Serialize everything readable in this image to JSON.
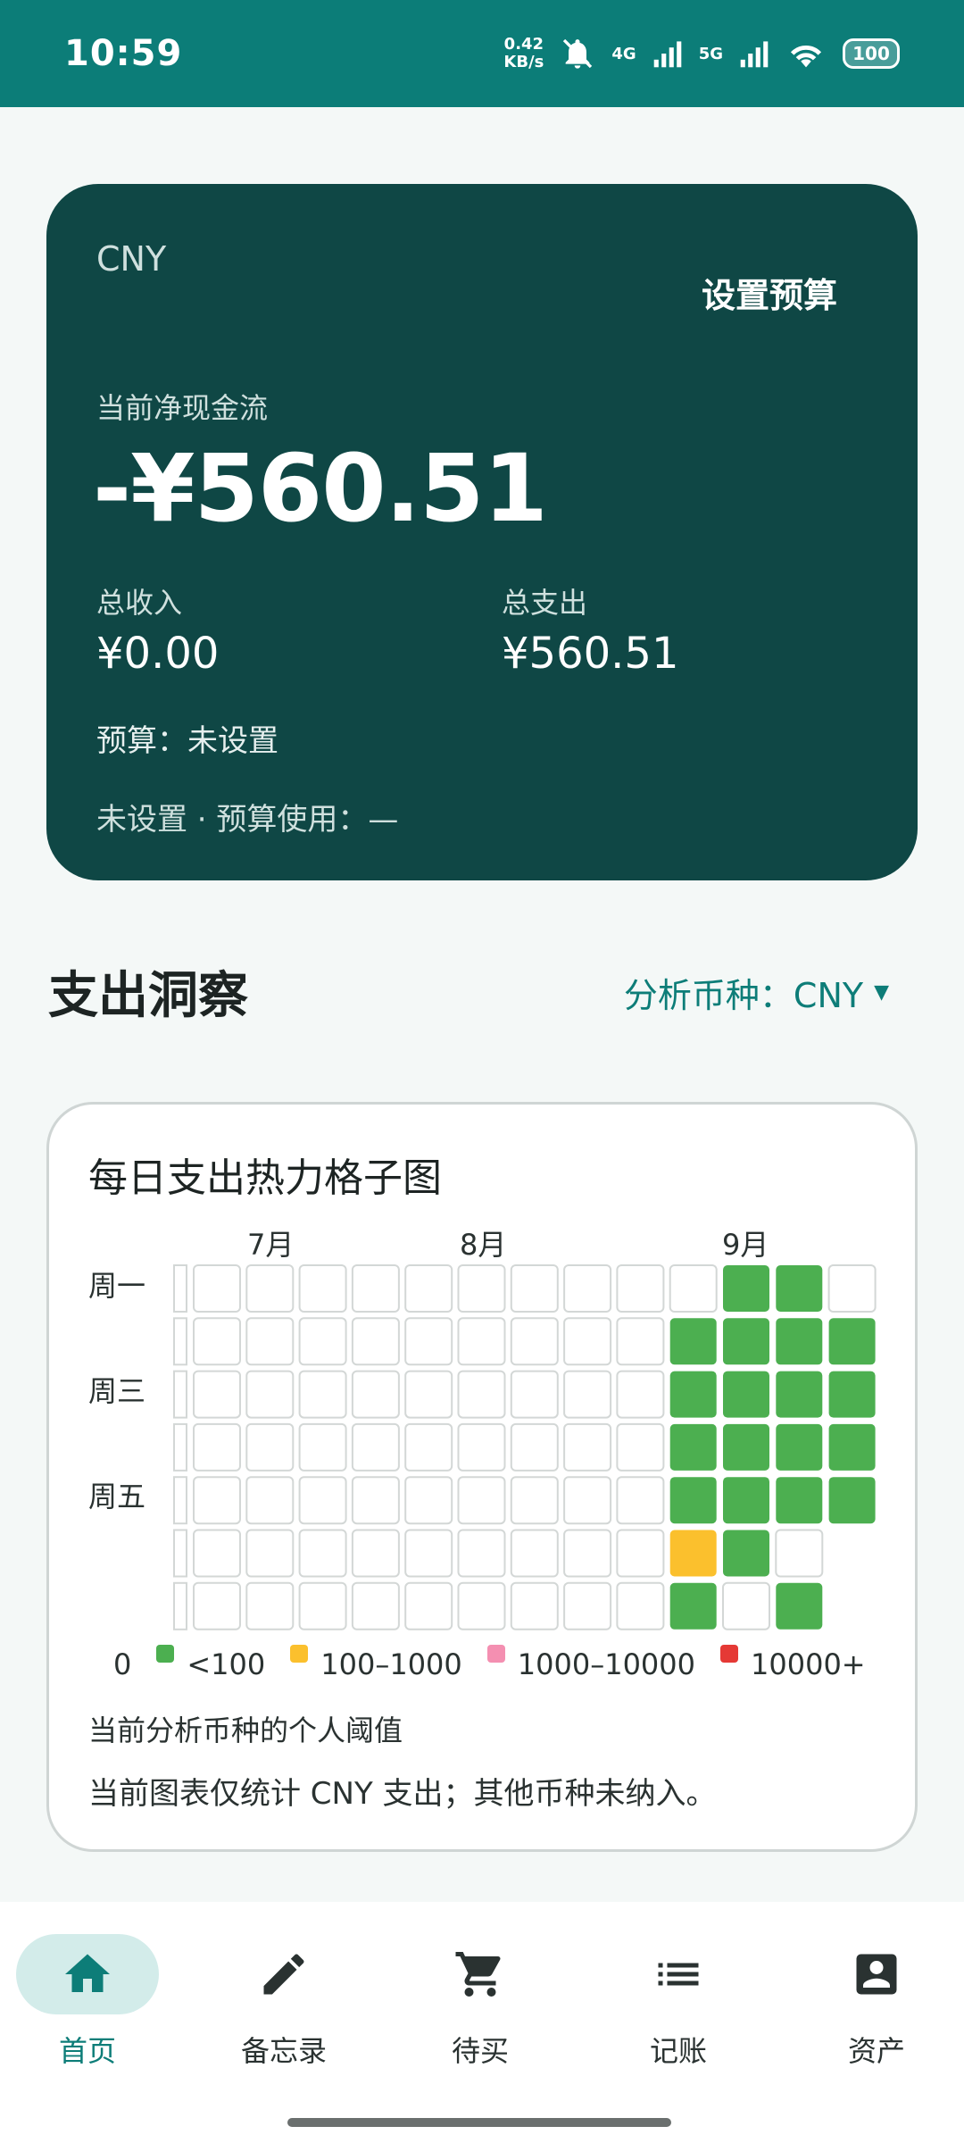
{
  "status_bar": {
    "time": "10:59",
    "speed_value": "0.42",
    "speed_unit": "KB/s",
    "net1": "4G",
    "net2": "5G",
    "battery": "100"
  },
  "net_card": {
    "currency": "CNY",
    "set_budget_label": "设置预算",
    "net_label": "当前净现金流",
    "net_value": "-¥560.51",
    "income_label": "总收入",
    "income_value": "¥0.00",
    "expense_label": "总支出",
    "expense_value": "¥560.51",
    "budget_line": "预算：未设置",
    "budget_usage": "未设置 · 预算使用：—"
  },
  "insights": {
    "title": "支出洞察",
    "currency_selector": "分析币种：CNY"
  },
  "heatmap": {
    "title": "每日支出热力格子图",
    "months": [
      "7月",
      "8月",
      "9月"
    ],
    "weekdays": [
      "周一",
      "周三",
      "周五"
    ],
    "colors": {
      "none": "#ffffff",
      "lt100": "#4caf50",
      "100_1000": "#fbc02d",
      "1000_10000": "#f48fb1",
      "gt10000": "#e53935"
    },
    "legend": [
      {
        "label": "0",
        "color": ""
      },
      {
        "label": "<100",
        "color": "#4caf50"
      },
      {
        "label": "100–1000",
        "color": "#fbc02d"
      },
      {
        "label": "1000–10000",
        "color": "#f48fb1"
      },
      {
        "label": "10000+",
        "color": "#e53935"
      }
    ],
    "columns": [
      [
        "e",
        "e",
        "e",
        "e",
        "e",
        "e",
        "e"
      ],
      [
        "e",
        "e",
        "e",
        "e",
        "e",
        "e",
        "e"
      ],
      [
        "e",
        "e",
        "e",
        "e",
        "e",
        "e",
        "e"
      ],
      [
        "e",
        "e",
        "e",
        "e",
        "e",
        "e",
        "e"
      ],
      [
        "e",
        "e",
        "e",
        "e",
        "e",
        "e",
        "e"
      ],
      [
        "e",
        "e",
        "e",
        "e",
        "e",
        "e",
        "e"
      ],
      [
        "e",
        "e",
        "e",
        "e",
        "e",
        "e",
        "e"
      ],
      [
        "e",
        "e",
        "e",
        "e",
        "e",
        "e",
        "e"
      ],
      [
        "e",
        "e",
        "e",
        "e",
        "e",
        "e",
        "e"
      ],
      [
        "e",
        "g",
        "g",
        "g",
        "g",
        "y",
        "g"
      ],
      [
        "g",
        "g",
        "g",
        "g",
        "g",
        "g",
        "e"
      ],
      [
        "g",
        "g",
        "g",
        "g",
        "g",
        "e",
        "g"
      ],
      [
        "e",
        "g",
        "g",
        "g",
        "g",
        "",
        ""
      ]
    ],
    "note_threshold": "当前分析币种的个人阈值",
    "note_currency": "当前图表仅统计 CNY 支出；其他币种未纳入。"
  },
  "bottom_nav": {
    "items": [
      {
        "label": "首页",
        "icon": "home-icon",
        "active": true
      },
      {
        "label": "备忘录",
        "icon": "pencil-icon",
        "active": false
      },
      {
        "label": "待买",
        "icon": "cart-icon",
        "active": false
      },
      {
        "label": "记账",
        "icon": "list-icon",
        "active": false
      },
      {
        "label": "资产",
        "icon": "account-box-icon",
        "active": false
      }
    ]
  }
}
